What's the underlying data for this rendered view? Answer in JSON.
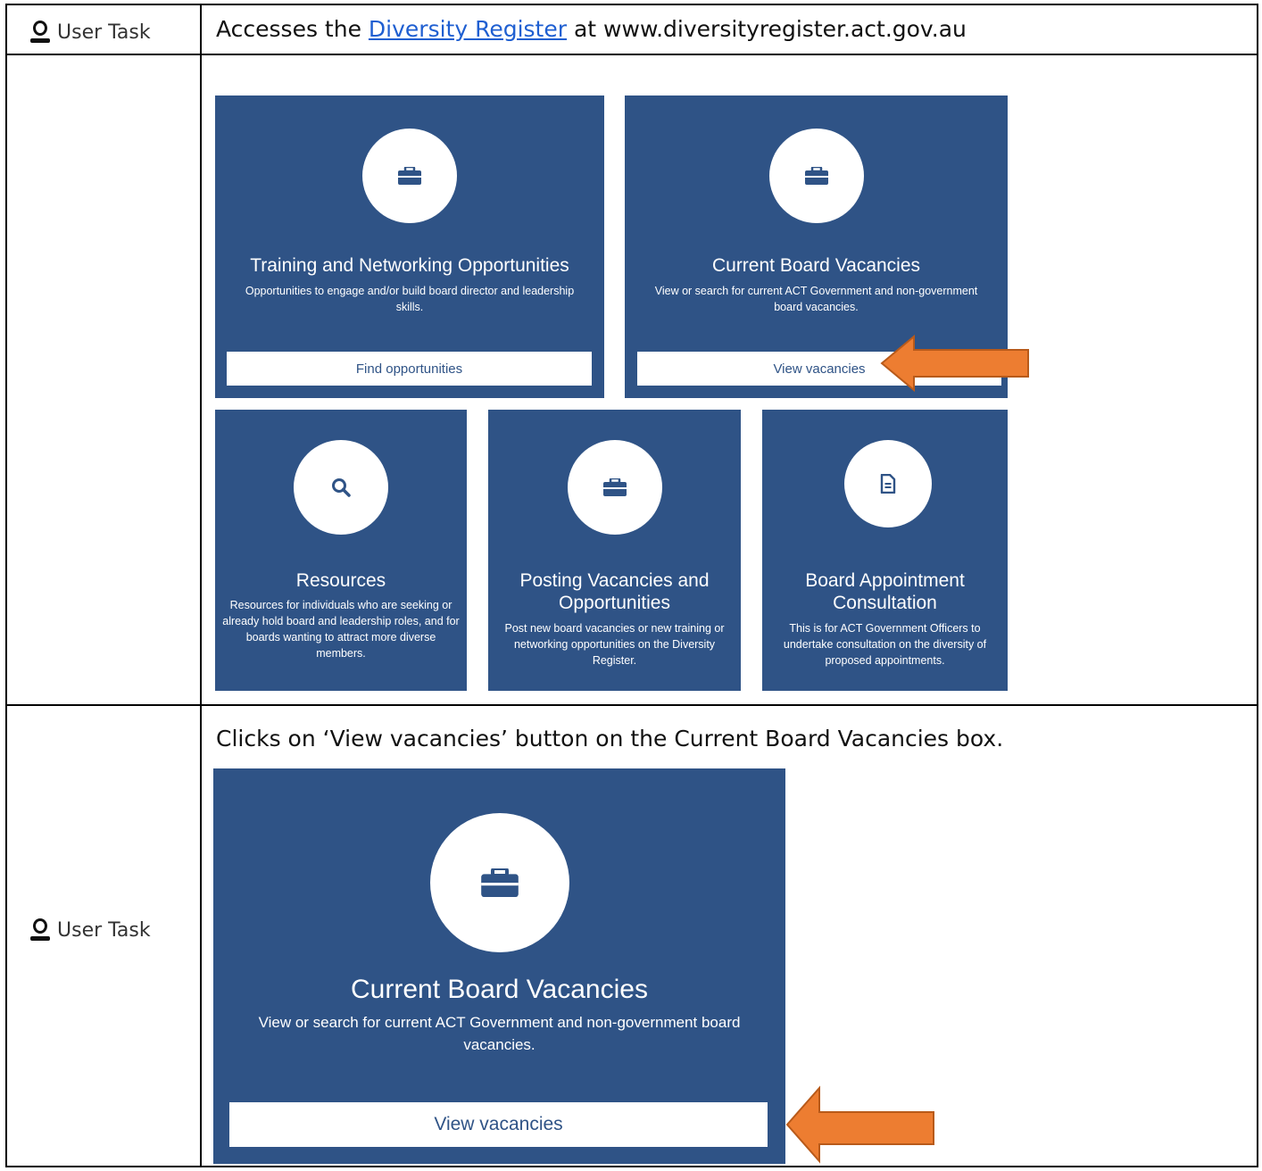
{
  "rows": [
    {
      "role_label": "User Task",
      "text_prefix": "Accesses the",
      "link_text": "Diversity Register",
      "text_suffix": "at www.diversityregister.act.gov.au"
    },
    {
      "role_label": "User Task",
      "text": "Clicks on ‘View vacancies’ button on the Current Board Vacancies box."
    }
  ],
  "tiles": [
    {
      "icon": "briefcase-icon",
      "title": "Training and Networking Opportunities",
      "description": "Opportunities to engage and/or build board director and leadership skills.",
      "button": "Find opportunities"
    },
    {
      "icon": "briefcase-icon",
      "title": "Current Board Vacancies",
      "description": "View or search for current ACT Government and non-government board vacancies.",
      "button": "View vacancies"
    },
    {
      "icon": "search-icon",
      "title": "Resources",
      "description": "Resources for individuals who are seeking or already hold board and leadership roles, and for boards wanting to attract more diverse members."
    },
    {
      "icon": "briefcase-icon",
      "title": "Posting Vacancies and Opportunities",
      "description": "Post new board vacancies or new training or networking opportunities on the Diversity Register."
    },
    {
      "icon": "document-icon",
      "title": "Board Appointment Consultation",
      "description": "This is for ACT Government Officers to undertake consultation on the diversity of proposed appointments."
    }
  ],
  "zoom_tile": {
    "icon": "briefcase-icon",
    "title": "Current Board Vacancies",
    "description": "View or search for current ACT Government and non-government board vacancies.",
    "button": "View vacancies"
  },
  "colors": {
    "tile_bg": "#2f5386",
    "arrow_fill": "#ed7d31",
    "arrow_stroke": "#b85a1a",
    "link": "#1f5fd1"
  }
}
